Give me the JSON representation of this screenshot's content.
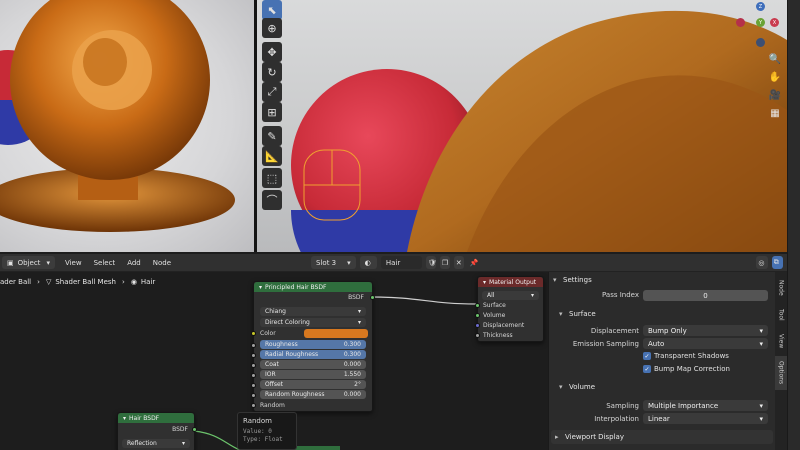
{
  "header": {
    "mode": "Object",
    "menus": [
      "View",
      "Select",
      "Add",
      "Node"
    ],
    "slot": "Slot 3",
    "material": "Hair"
  },
  "breadcrumb": {
    "items": [
      "ader Ball",
      "Shader Ball Mesh",
      "Hair"
    ]
  },
  "nodes": {
    "principled": {
      "title": "Principled Hair BSDF",
      "output": "BSDF",
      "model": "Chiang",
      "parametrization": "Direct Coloring",
      "color_label": "Color",
      "color_value": "#d7781f",
      "params": [
        {
          "label": "Roughness",
          "value": "0.300"
        },
        {
          "label": "Radial Roughness",
          "value": "0.300"
        },
        {
          "label": "Coat",
          "value": "0.000"
        },
        {
          "label": "IOR",
          "value": "1.550"
        },
        {
          "label": "Offset",
          "value": "2°"
        },
        {
          "label": "Random Roughness",
          "value": "0.000"
        }
      ],
      "random_label": "Random"
    },
    "output": {
      "title": "Material Output",
      "target": "All",
      "inputs": [
        "Surface",
        "Volume",
        "Displacement",
        "Thickness"
      ]
    },
    "hair": {
      "title": "Hair BSDF",
      "output": "BSDF",
      "component": "Reflection"
    }
  },
  "tooltip": {
    "title": "Random",
    "value": "Value: 0",
    "type": "Type: Float"
  },
  "properties": {
    "settings_title": "Settings",
    "pass_index_label": "Pass Index",
    "pass_index_value": "0",
    "surface_title": "Surface",
    "displacement_label": "Displacement",
    "displacement_value": "Bump Only",
    "emission_label": "Emission Sampling",
    "emission_value": "Auto",
    "transparent_shadows": "Transparent Shadows",
    "bump_map_correction": "Bump Map Correction",
    "volume_title": "Volume",
    "sampling_label": "Sampling",
    "sampling_value": "Multiple Importance",
    "interpolation_label": "Interpolation",
    "interpolation_value": "Linear",
    "viewport_display_title": "Viewport Display",
    "tabs": [
      "Node",
      "Tool",
      "View",
      "Options"
    ]
  },
  "gizmo": {
    "z_label": "Z",
    "y_label": "Y",
    "x_label": "X"
  },
  "colors": {
    "accent": "#4772b3",
    "node_green": "#2f6e3d",
    "node_red": "#6b2a2a",
    "hair_orange": "#d7781f",
    "ball_red": "#c72a37",
    "ball_blue": "#2f3aa6"
  }
}
